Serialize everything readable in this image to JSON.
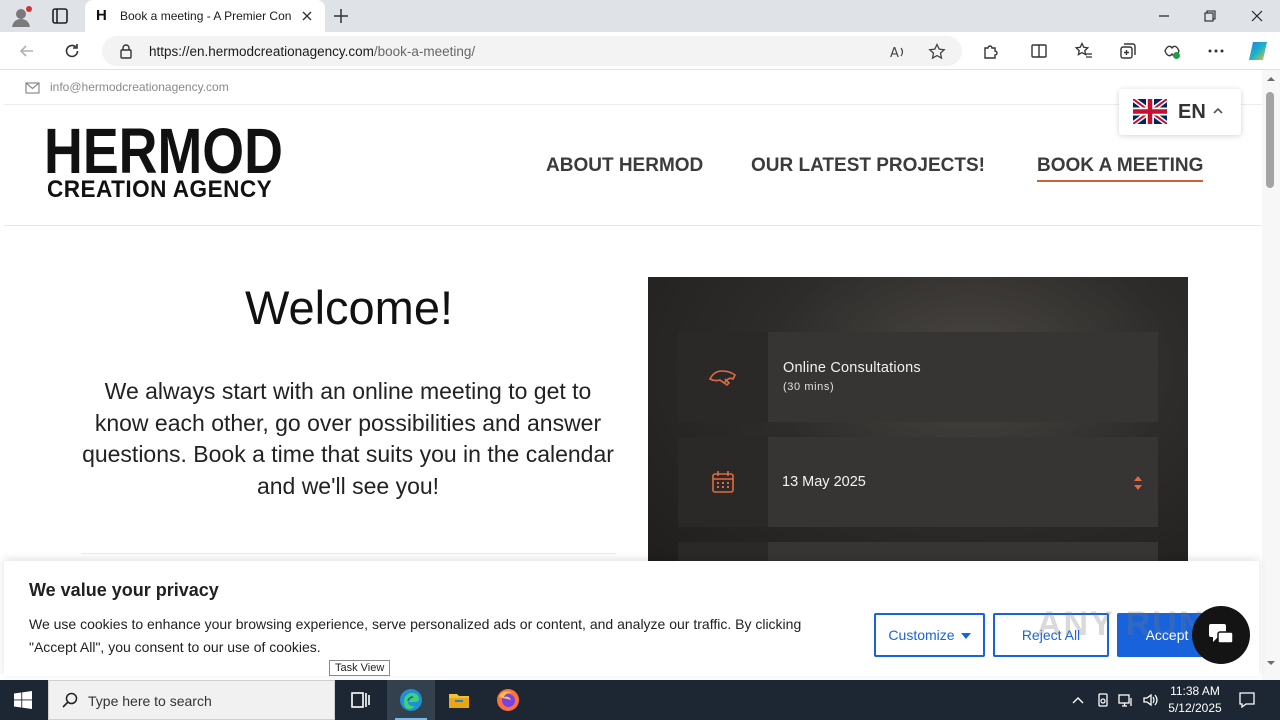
{
  "browser": {
    "tab_favicon": "H",
    "tab_title": "Book a meeting - A Premier Con",
    "url_host": "https://en.hermodcreationagency.com",
    "url_path": "/book-a-meeting/"
  },
  "site": {
    "email": "info@hermodcreationagency.com",
    "logo_line1": "HERMOD",
    "logo_line2": "CREATION AGENCY",
    "nav": [
      "ABOUT HERMOD",
      "OUR LATEST PROJECTS!",
      "BOOK A MEETING"
    ],
    "active_nav": "BOOK A MEETING",
    "lang": {
      "code": "EN",
      "flag": "uk-flag-icon"
    }
  },
  "main": {
    "welcome": "Welcome!",
    "intro": "We always start with an online meeting to get to know each other, go over possibilities and answer questions. Book a time that suits you in the calendar and we'll see you!",
    "service_title": "Online Consultations",
    "service_duration": "(30 mins)",
    "date": "13 May 2025"
  },
  "cookie": {
    "title": "We value your privacy",
    "text": "We use cookies to enhance your browsing experience, serve personalized ads or content, and analyze our traffic. By clicking \"Accept All\", you consent to our use of cookies.",
    "customize": "Customize",
    "reject": "Reject All",
    "accept": "Accept"
  },
  "watermark": "ANY RUN",
  "tooltip": "Task View",
  "taskbar": {
    "search_placeholder": "Type here to search",
    "time": "11:38 AM",
    "date": "5/12/2025"
  },
  "colors": {
    "accent": "#c9643a",
    "booking_bg": "#2e2c2a",
    "cookie_blue": "#1863dc",
    "taskbar": "#1c2733"
  }
}
